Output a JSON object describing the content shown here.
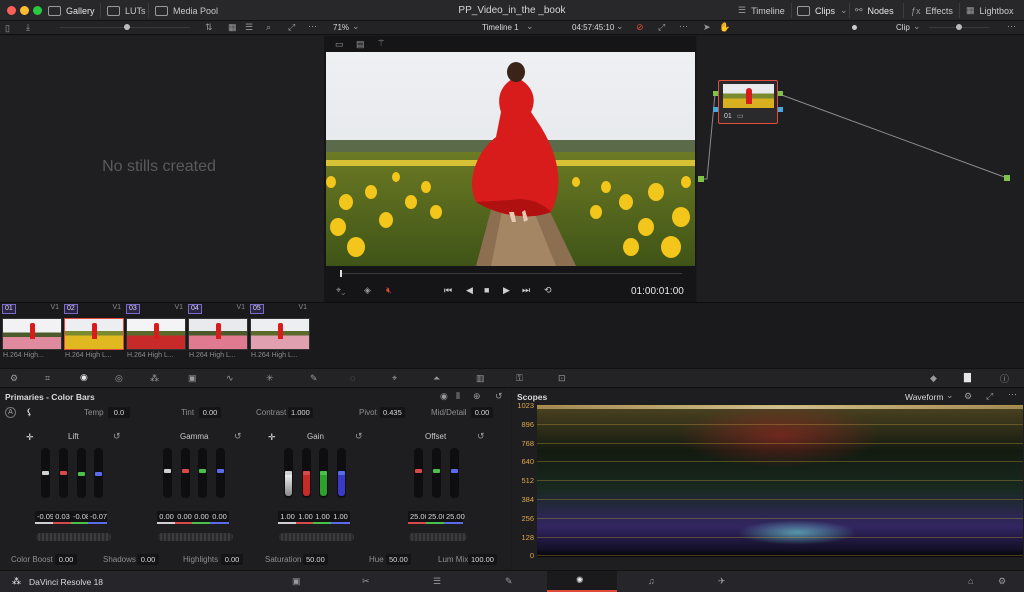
{
  "titlebar": {
    "gallery": "Gallery",
    "luts": "LUTs",
    "media_pool": "Media Pool",
    "project_title": "PP_Video_in_the _book",
    "timeline": "Timeline",
    "clips": "Clips",
    "nodes": "Nodes",
    "effects": "Effects",
    "lightbox": "Lightbox"
  },
  "viewer_bar": {
    "zoom": "71%",
    "timeline_name": "Timeline 1",
    "timecode": "04:57:45:10",
    "clip_mode": "Clip"
  },
  "gallery": {
    "empty_text": "No stills created"
  },
  "transport": {
    "timecode": "01:00:01:00"
  },
  "node": {
    "label": "01"
  },
  "clips": [
    {
      "num": "01",
      "track": "V1",
      "label": "H.264 High..."
    },
    {
      "num": "02",
      "track": "V1",
      "label": "H.264 High L..."
    },
    {
      "num": "03",
      "track": "V1",
      "label": "H.264 High L..."
    },
    {
      "num": "04",
      "track": "V1",
      "label": "H.264 High L..."
    },
    {
      "num": "05",
      "track": "V1",
      "label": "H.264 High L..."
    }
  ],
  "primaries": {
    "title": "Primaries - Color Bars",
    "top": {
      "temp_label": "Temp",
      "temp": "0.0",
      "tint_label": "Tint",
      "tint": "0.00",
      "contrast_label": "Contrast",
      "contrast": "1.000",
      "pivot_label": "Pivot",
      "pivot": "0.435",
      "middetail_label": "Mid/Detail",
      "middetail": "0.00"
    },
    "wheels": {
      "lift": {
        "name": "Lift",
        "y": "-0.09",
        "r": "0.03",
        "g": "-0.08",
        "b": "-0.07"
      },
      "gamma": {
        "name": "Gamma",
        "y": "0.00",
        "r": "0.00",
        "g": "0.00",
        "b": "0.00"
      },
      "gain": {
        "name": "Gain",
        "y": "1.00",
        "r": "1.00",
        "g": "1.00",
        "b": "1.00"
      },
      "offset": {
        "name": "Offset",
        "r": "25.00",
        "g": "25.00",
        "b": "25.00"
      }
    },
    "bottom": {
      "colorboost_label": "Color Boost",
      "colorboost": "0.00",
      "shadows_label": "Shadows",
      "shadows": "0.00",
      "highlights_label": "Highlights",
      "highlights": "0.00",
      "saturation_label": "Saturation",
      "saturation": "50.00",
      "hue_label": "Hue",
      "hue": "50.00",
      "lummix_label": "Lum Mix",
      "lummix": "100.00"
    }
  },
  "scopes": {
    "title": "Scopes",
    "mode": "Waveform",
    "scale": [
      "1023",
      "896",
      "768",
      "640",
      "512",
      "384",
      "256",
      "128",
      "0"
    ]
  },
  "app": {
    "name": "DaVinci Resolve 18"
  },
  "colors": {
    "accent_red": "#e04a3a",
    "node_green": "#7ec24a",
    "clip_purple": "#7b68c8"
  }
}
